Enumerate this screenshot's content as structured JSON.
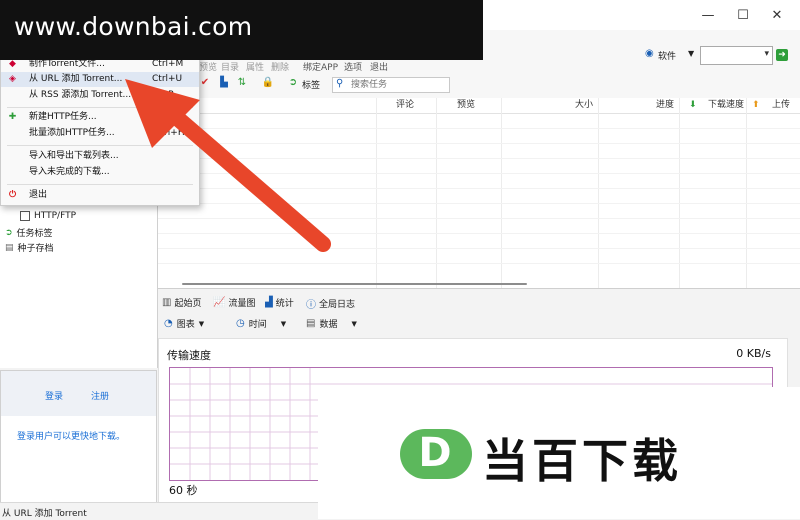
{
  "window": {
    "min_label": "—",
    "max_label": "☐",
    "close_label": "✕"
  },
  "watermark": {
    "text": "www.downbai.com",
    "logo_letter": "D",
    "logo_text": "当百下载"
  },
  "toolbar": {
    "items": [
      "预览",
      "目录",
      "属性",
      "删除",
      "绑定APP",
      "选项",
      "退出"
    ],
    "tags_label": "标签",
    "search_placeholder": "搜索任务",
    "software_label": "软件"
  },
  "columns": [
    "评论",
    "预览",
    "大小",
    "进度",
    "下载速度",
    "上传"
  ],
  "sidebar": {
    "tree": [
      {
        "label": "HTTP/FTP",
        "icon": "checkbox-icon"
      },
      {
        "label": "任务标签",
        "icon": "tag-icon"
      },
      {
        "label": "种子存档",
        "icon": "archive-icon"
      }
    ],
    "login_label": "登录",
    "register_label": "注册",
    "hint": "登录用户可以更快地下载。"
  },
  "bottom_tabs": [
    {
      "label": "起始页",
      "icon": "home-icon"
    },
    {
      "label": "流量图",
      "icon": "chart-icon"
    },
    {
      "label": "统计",
      "icon": "stats-icon"
    },
    {
      "label": "全局日志",
      "icon": "info-icon"
    }
  ],
  "graph_toolbar": {
    "chart_label": "图表",
    "time_label": "时间",
    "data_label": "数据"
  },
  "graph": {
    "title": "传输速度",
    "rate": "0 KB/s",
    "x_label": "60 秒"
  },
  "menu": {
    "items": [
      {
        "label": "制作Torrent文件...",
        "shortcut": "Ctrl+M",
        "icon": "torrent-icon"
      },
      {
        "label": "从 URL 添加 Torrent...",
        "shortcut": "Ctrl+U",
        "icon": "url-torrent-icon"
      },
      {
        "label": "从 RSS 源添加 Torrent...",
        "shortcut": "...+R",
        "icon": ""
      },
      {
        "label": "新建HTTP任务...",
        "shortcut": "",
        "icon": "http-task-icon"
      },
      {
        "label": "批量添加HTTP任务...",
        "shortcut": "...trl+H",
        "icon": ""
      },
      {
        "label": "导入和导出下载列表...",
        "shortcut": "",
        "icon": ""
      },
      {
        "label": "导入未完成的下载...",
        "shortcut": "",
        "icon": ""
      },
      {
        "label": "退出",
        "shortcut": "",
        "icon": "exit-icon"
      }
    ]
  },
  "status": {
    "text": "从 URL 添加 Torrent"
  },
  "colors": {
    "arrow": "#e8462a",
    "logo_green": "#5cb85c",
    "graph_border": "#b06cb0",
    "link": "#1a6fd6"
  }
}
